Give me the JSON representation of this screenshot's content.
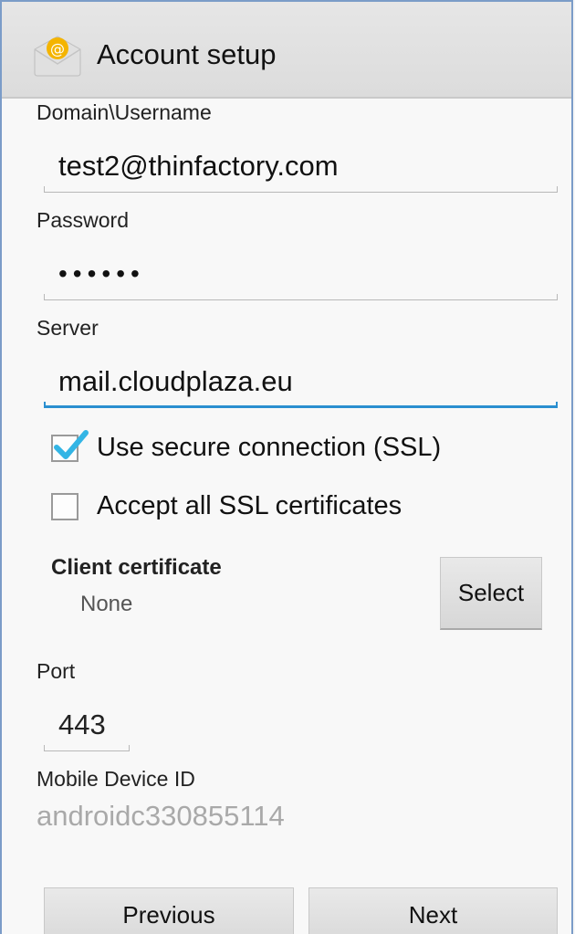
{
  "action_bar": {
    "title": "Account setup",
    "icon": "email-app-icon"
  },
  "fields": {
    "username": {
      "label": "Domain\\Username",
      "value": "test2@thinfactory.com"
    },
    "password": {
      "label": "Password",
      "value": "••••••"
    },
    "server": {
      "label": "Server",
      "value": "mail.cloudplaza.eu"
    }
  },
  "options": {
    "ssl": {
      "label": "Use secure connection (SSL)",
      "checked": true
    },
    "accept_all": {
      "label": "Accept all SSL certificates",
      "checked": false
    }
  },
  "client_certificate": {
    "title": "Client certificate",
    "value": "None",
    "button": "Select"
  },
  "port": {
    "label": "Port",
    "value": "443"
  },
  "device": {
    "label": "Mobile Device ID",
    "value": "androidc330855114"
  },
  "nav": {
    "previous": "Previous",
    "next": "Next"
  },
  "colors": {
    "accent": "#2a8fd0",
    "checkmark": "#33b5e5"
  }
}
